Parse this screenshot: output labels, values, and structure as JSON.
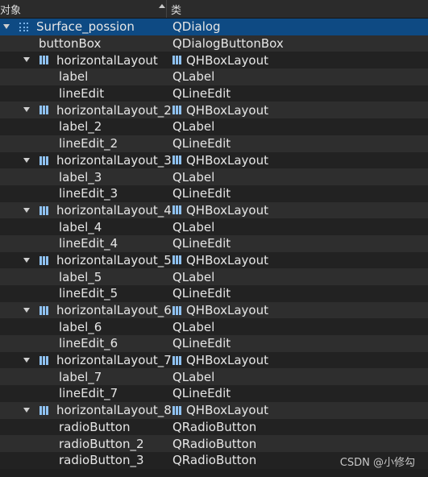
{
  "header": {
    "col_object": "对象",
    "col_class": "类"
  },
  "colors": {
    "selected_row": "#0e4a83",
    "alt_row": "#2e2e2e",
    "base_row": "#222222",
    "layout_icon": "#8fc2f2"
  },
  "rows": [
    {
      "object": "Surface_possion",
      "class": "QDialog",
      "icon": "grid-icon",
      "level": 0,
      "expander": true,
      "selected": true
    },
    {
      "object": "buttonBox",
      "class": "QDialogButtonBox",
      "icon": "",
      "level": 1,
      "expander": false
    },
    {
      "object": "horizontalLayout",
      "class": "QHBoxLayout",
      "icon": "hbox-layout-icon",
      "level": 1,
      "expander": true
    },
    {
      "object": "label",
      "class": "QLabel",
      "icon": "",
      "level": 2,
      "expander": false
    },
    {
      "object": "lineEdit",
      "class": "QLineEdit",
      "icon": "",
      "level": 2,
      "expander": false
    },
    {
      "object": "horizontalLayout_2",
      "class": "QHBoxLayout",
      "icon": "hbox-layout-icon",
      "level": 1,
      "expander": true
    },
    {
      "object": "label_2",
      "class": "QLabel",
      "icon": "",
      "level": 2,
      "expander": false
    },
    {
      "object": "lineEdit_2",
      "class": "QLineEdit",
      "icon": "",
      "level": 2,
      "expander": false
    },
    {
      "object": "horizontalLayout_3",
      "class": "QHBoxLayout",
      "icon": "hbox-layout-icon",
      "level": 1,
      "expander": true
    },
    {
      "object": "label_3",
      "class": "QLabel",
      "icon": "",
      "level": 2,
      "expander": false
    },
    {
      "object": "lineEdit_3",
      "class": "QLineEdit",
      "icon": "",
      "level": 2,
      "expander": false
    },
    {
      "object": "horizontalLayout_4",
      "class": "QHBoxLayout",
      "icon": "hbox-layout-icon",
      "level": 1,
      "expander": true
    },
    {
      "object": "label_4",
      "class": "QLabel",
      "icon": "",
      "level": 2,
      "expander": false
    },
    {
      "object": "lineEdit_4",
      "class": "QLineEdit",
      "icon": "",
      "level": 2,
      "expander": false
    },
    {
      "object": "horizontalLayout_5",
      "class": "QHBoxLayout",
      "icon": "hbox-layout-icon",
      "level": 1,
      "expander": true
    },
    {
      "object": "label_5",
      "class": "QLabel",
      "icon": "",
      "level": 2,
      "expander": false
    },
    {
      "object": "lineEdit_5",
      "class": "QLineEdit",
      "icon": "",
      "level": 2,
      "expander": false
    },
    {
      "object": "horizontalLayout_6",
      "class": "QHBoxLayout",
      "icon": "hbox-layout-icon",
      "level": 1,
      "expander": true
    },
    {
      "object": "label_6",
      "class": "QLabel",
      "icon": "",
      "level": 2,
      "expander": false
    },
    {
      "object": "lineEdit_6",
      "class": "QLineEdit",
      "icon": "",
      "level": 2,
      "expander": false
    },
    {
      "object": "horizontalLayout_7",
      "class": "QHBoxLayout",
      "icon": "hbox-layout-icon",
      "level": 1,
      "expander": true
    },
    {
      "object": "label_7",
      "class": "QLabel",
      "icon": "",
      "level": 2,
      "expander": false
    },
    {
      "object": "lineEdit_7",
      "class": "QLineEdit",
      "icon": "",
      "level": 2,
      "expander": false
    },
    {
      "object": "horizontalLayout_8",
      "class": "QHBoxLayout",
      "icon": "hbox-layout-icon",
      "level": 1,
      "expander": true
    },
    {
      "object": "radioButton",
      "class": "QRadioButton",
      "icon": "",
      "level": 2,
      "expander": false
    },
    {
      "object": "radioButton_2",
      "class": "QRadioButton",
      "icon": "",
      "level": 2,
      "expander": false
    },
    {
      "object": "radioButton_3",
      "class": "QRadioButton",
      "icon": "",
      "level": 2,
      "expander": false
    }
  ],
  "watermark": "CSDN @小修勾"
}
